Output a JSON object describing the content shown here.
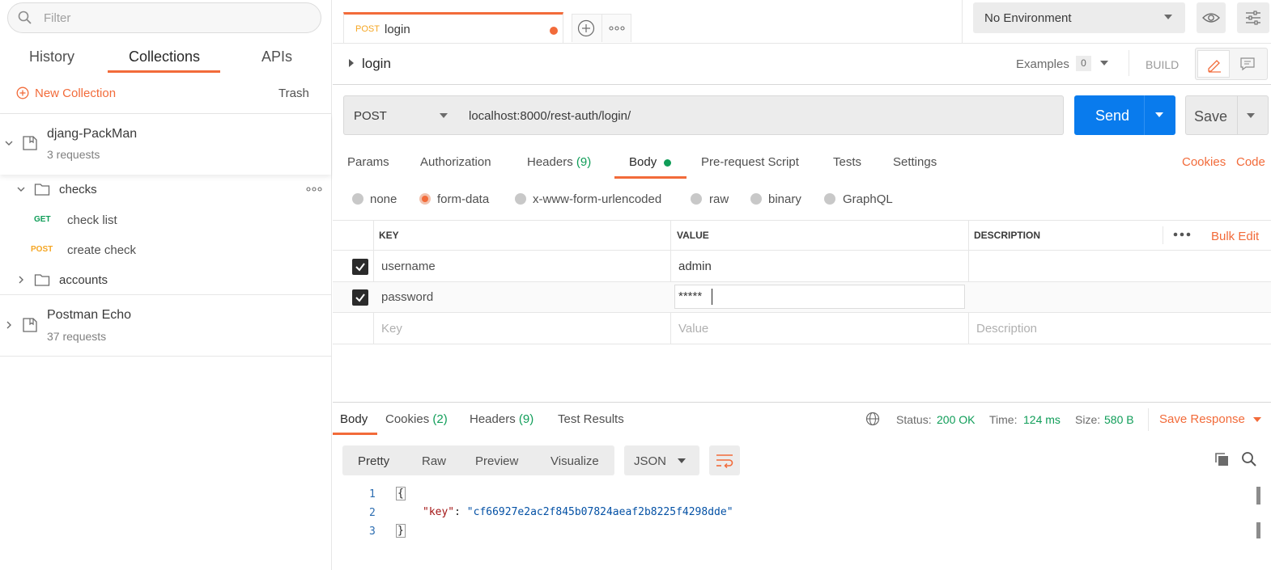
{
  "sidebar": {
    "filter_placeholder": "Filter",
    "tabs": [
      "History",
      "Collections",
      "APIs"
    ],
    "new_collection": "New Collection",
    "trash": "Trash",
    "collections": [
      {
        "name": "djang-PackMan",
        "count": "3 requests"
      },
      {
        "name": "Postman Echo",
        "count": "37 requests"
      }
    ],
    "folders": [
      {
        "name": "checks"
      },
      {
        "name": "accounts"
      }
    ],
    "requests": [
      {
        "method": "GET",
        "name": "check list"
      },
      {
        "method": "POST",
        "name": "create check"
      }
    ]
  },
  "tab": {
    "method": "POST",
    "name": "login"
  },
  "environment": "No Environment",
  "request": {
    "title": "login",
    "examples_label": "Examples",
    "examples_count": "0",
    "build": "BUILD",
    "method": "POST",
    "url": "localhost:8000/rest-auth/login/",
    "send": "Send",
    "save": "Save"
  },
  "req_tabs": {
    "params": "Params",
    "authorization": "Authorization",
    "headers": "Headers",
    "headers_count": "(9)",
    "body": "Body",
    "prerequest": "Pre-request Script",
    "tests": "Tests",
    "settings": "Settings",
    "cookies": "Cookies",
    "code": "Code"
  },
  "body_types": [
    "none",
    "form-data",
    "x-www-form-urlencoded",
    "raw",
    "binary",
    "GraphQL"
  ],
  "table": {
    "headers": [
      "KEY",
      "VALUE",
      "DESCRIPTION"
    ],
    "bulk_edit": "Bulk Edit",
    "rows": [
      {
        "key": "username",
        "value": "admin"
      },
      {
        "key": "password",
        "value": "*****"
      }
    ],
    "placeholders": {
      "key": "Key",
      "value": "Value",
      "description": "Description"
    }
  },
  "response": {
    "tabs": {
      "body": "Body",
      "cookies": "Cookies",
      "cookies_count": "(2)",
      "headers": "Headers",
      "headers_count": "(9)",
      "tests": "Test Results"
    },
    "status_label": "Status:",
    "status": "200 OK",
    "time_label": "Time:",
    "time": "124 ms",
    "size_label": "Size:",
    "size": "580 B",
    "save_response": "Save Response",
    "views": [
      "Pretty",
      "Raw",
      "Preview",
      "Visualize"
    ],
    "format": "JSON",
    "lines": [
      "1",
      "2",
      "3"
    ],
    "code": {
      "open": "{",
      "key": "\"key\"",
      "colon": ": ",
      "value": "\"cf66927e2ac2f845b07824aeaf2b8225f4298dde\"",
      "close": "}"
    }
  },
  "colors": {
    "accent": "#f26b3a",
    "send": "#097bed",
    "success": "#0f9d58",
    "get": "#0f9d58",
    "post": "#f5a623"
  }
}
